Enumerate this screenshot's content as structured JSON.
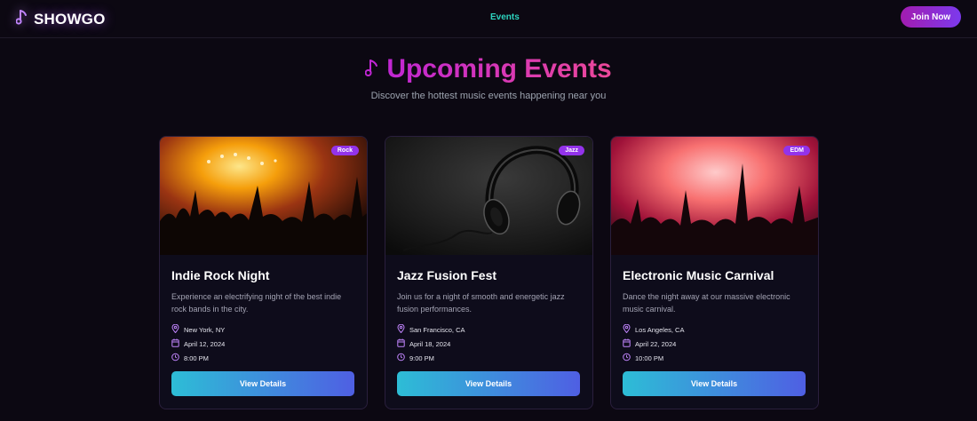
{
  "brand": {
    "name": "SHOWGO",
    "icon": "music-note-icon",
    "accent": "#c084fc"
  },
  "nav": {
    "events_label": "Events",
    "join_label": "Join Now"
  },
  "hero": {
    "title": "Upcoming Events",
    "subtitle": "Discover the hottest music events happening near you"
  },
  "colors": {
    "background": "#0c0812",
    "badge": "#9333ea",
    "nav_link": "#2dd4bf",
    "button_gradient": [
      "#2dbdd6",
      "#4f5fe3"
    ],
    "title_gradient": [
      "#c026d3",
      "#ec4899"
    ]
  },
  "events": [
    {
      "genre": "Rock",
      "title": "Indie Rock Night",
      "description": "Experience an electrifying night of the best indie rock bands in the city.",
      "location": "New York, NY",
      "date": "April 12, 2024",
      "time": "8:00 PM",
      "button": "View Details"
    },
    {
      "genre": "Jazz",
      "title": "Jazz Fusion Fest",
      "description": "Join us for a night of smooth and energetic jazz fusion performances.",
      "location": "San Francisco, CA",
      "date": "April 18, 2024",
      "time": "9:00 PM",
      "button": "View Details"
    },
    {
      "genre": "EDM",
      "title": "Electronic Music Carnival",
      "description": "Dance the night away at our massive electronic music carnival.",
      "location": "Los Angeles, CA",
      "date": "April 22, 2024",
      "time": "10:00 PM",
      "button": "View Details"
    }
  ]
}
